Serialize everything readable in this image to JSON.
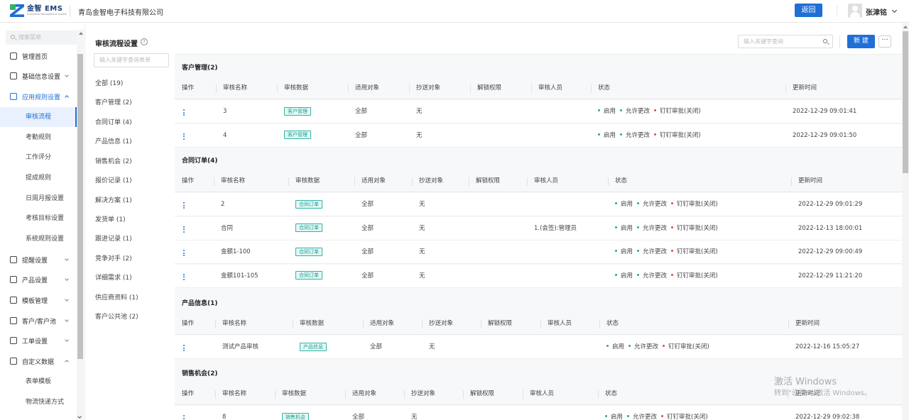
{
  "header": {
    "logo_text": "金智 EMS",
    "logo_subtext": "Enterprise Management System",
    "company": "青岛金智电子科技有限公司",
    "back_button": "返回",
    "username": "张津铭"
  },
  "leftnav": {
    "search_placeholder": "搜索菜单",
    "items": [
      {
        "label": "管理首页",
        "icon": "home-icon"
      },
      {
        "label": "基础信息设置",
        "icon": "cube-icon"
      },
      {
        "label": "应用规则设置",
        "icon": "document-icon"
      },
      {
        "label": "提醒设置",
        "icon": "bell-icon"
      },
      {
        "label": "产品设置",
        "icon": "package-icon"
      },
      {
        "label": "模板管理",
        "icon": "template-icon"
      },
      {
        "label": "客户/客户池",
        "icon": "customer-icon"
      },
      {
        "label": "工单设置",
        "icon": "ticket-icon"
      },
      {
        "label": "自定义数据",
        "icon": "custom-data-icon"
      }
    ],
    "sub_rules": [
      "审核流程",
      "考勤规则",
      "工作评分",
      "提成规则",
      "日周月报设置",
      "考核目标设置",
      "系统规则设置"
    ],
    "sub_custom": [
      "表单模板",
      "物流快递方式"
    ]
  },
  "catcol": {
    "title": "审核流程设置",
    "search_placeholder": "输入关键字查询表单",
    "items": [
      "全部 (19)",
      "客户管理 (2)",
      "合同订单 (4)",
      "产品信息 (1)",
      "销售机会 (2)",
      "报价记录 (1)",
      "解决方案 (1)",
      "发货单 (1)",
      "跟进记录 (1)",
      "竞争对手 (2)",
      "详细需求 (1)",
      "供应商资料 (1)",
      "客户公共池 (2)"
    ]
  },
  "toolbar": {
    "search_placeholder": "输入关键字查询",
    "new_button": "新 建",
    "more_button": "···"
  },
  "table_headers": [
    "操作",
    "审核名称",
    "审核数据",
    "适用对象",
    "抄送对象",
    "解锁权限",
    "审核人员",
    "状态",
    "更新时间"
  ],
  "status_labels": [
    "启用",
    "允许更改",
    "钉钉审批(关闭)"
  ],
  "sections": [
    {
      "title": "客户管理(2)",
      "rows": [
        {
          "name": "3",
          "tag": "客户管理",
          "target": "全部",
          "cc": "无",
          "unlock": "",
          "reviewer": "",
          "time": "2022-12-29 09:01:41"
        },
        {
          "name": "4",
          "tag": "客户管理",
          "target": "全部",
          "cc": "无",
          "unlock": "",
          "reviewer": "",
          "time": "2022-12-29 09:01:50"
        }
      ]
    },
    {
      "title": "合同订单(4)",
      "rows": [
        {
          "name": "2",
          "tag": "合同订单",
          "target": "全部",
          "cc": "无",
          "unlock": "",
          "reviewer": "",
          "time": "2022-12-29 09:01:29"
        },
        {
          "name": "合同",
          "tag": "合同订单",
          "target": "全部",
          "cc": "无",
          "unlock": "",
          "reviewer": "1.(会签):管理员",
          "time": "2022-12-13 18:00:01"
        },
        {
          "name": "金额1-100",
          "tag": "合同订单",
          "target": "全部",
          "cc": "无",
          "unlock": "",
          "reviewer": "",
          "time": "2022-12-29 09:00:49"
        },
        {
          "name": "金额101-105",
          "tag": "合同订单",
          "target": "全部",
          "cc": "无",
          "unlock": "",
          "reviewer": "",
          "time": "2022-12-29 11:21:20"
        }
      ]
    },
    {
      "title": "产品信息(1)",
      "rows": [
        {
          "name": "测试产品审核",
          "tag": "产品信息",
          "target": "全部",
          "cc": "无",
          "unlock": "",
          "reviewer": "",
          "time": "2022-12-16 15:05:27"
        }
      ]
    },
    {
      "title": "销售机会(2)",
      "rows": [
        {
          "name": "8",
          "tag": "销售机会",
          "target": "全部",
          "cc": "无",
          "unlock": "",
          "reviewer": "",
          "time": "2022-12-29 09:02:38"
        }
      ]
    }
  ],
  "watermark": {
    "line1": "激活 Windows",
    "line2": "转到\"设置\"以激活 Windows。"
  },
  "colors": {
    "accent": "#1f6fd6",
    "tag_border": "#2fb3a5",
    "status_green": "#27b06a",
    "status_red": "#e04a3f"
  }
}
